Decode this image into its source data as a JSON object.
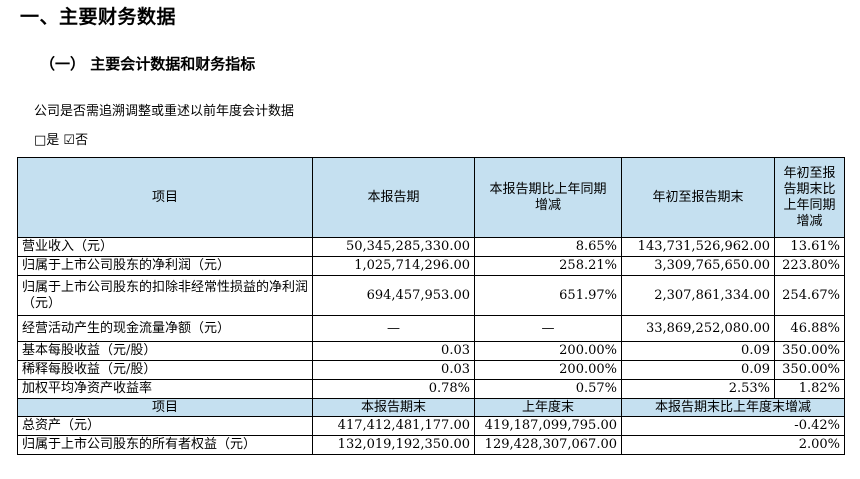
{
  "section_title": "一、主要财务数据",
  "subsection_title": "（一） 主要会计数据和财务指标",
  "restatement_question": "公司是否需追溯调整或重述以前年度会计数据",
  "restatement_answer": "□是 ☑否",
  "table1": {
    "headers": [
      "项目",
      "本报告期",
      "本报告期比上年同期增减",
      "年初至报告期末",
      "年初至报告期末比上年同期增减"
    ],
    "rows": [
      [
        "营业收入（元）",
        "50,345,285,330.00",
        "8.65%",
        "143,731,526,962.00",
        "13.61%"
      ],
      [
        "归属于上市公司股东的净利润（元）",
        "1,025,714,296.00",
        "258.21%",
        "3,309,765,650.00",
        "223.80%"
      ],
      [
        "归属于上市公司股东的扣除非经常性损益的净利润（元）",
        "694,457,953.00",
        "651.97%",
        "2,307,861,334.00",
        "254.67%"
      ],
      [
        "经营活动产生的现金流量净额（元）",
        "—",
        "—",
        "33,869,252,080.00",
        "46.88%"
      ],
      [
        "基本每股收益（元/股）",
        "0.03",
        "200.00%",
        "0.09",
        "350.00%"
      ],
      [
        "稀释每股收益（元/股）",
        "0.03",
        "200.00%",
        "0.09",
        "350.00%"
      ],
      [
        "加权平均净资产收益率",
        "0.78%",
        "0.57%",
        "2.53%",
        "1.82%"
      ]
    ]
  },
  "table2": {
    "headers": [
      "项目",
      "本报告期末",
      "上年度末",
      "本报告期末比上年度末增减"
    ],
    "rows": [
      [
        "总资产（元）",
        "417,412,481,177.00",
        "419,187,099,795.00",
        "-0.42%"
      ],
      [
        "归属于上市公司股东的所有者权益（元）",
        "132,019,192,350.00",
        "129,428,307,067.00",
        "2.00%"
      ]
    ]
  }
}
